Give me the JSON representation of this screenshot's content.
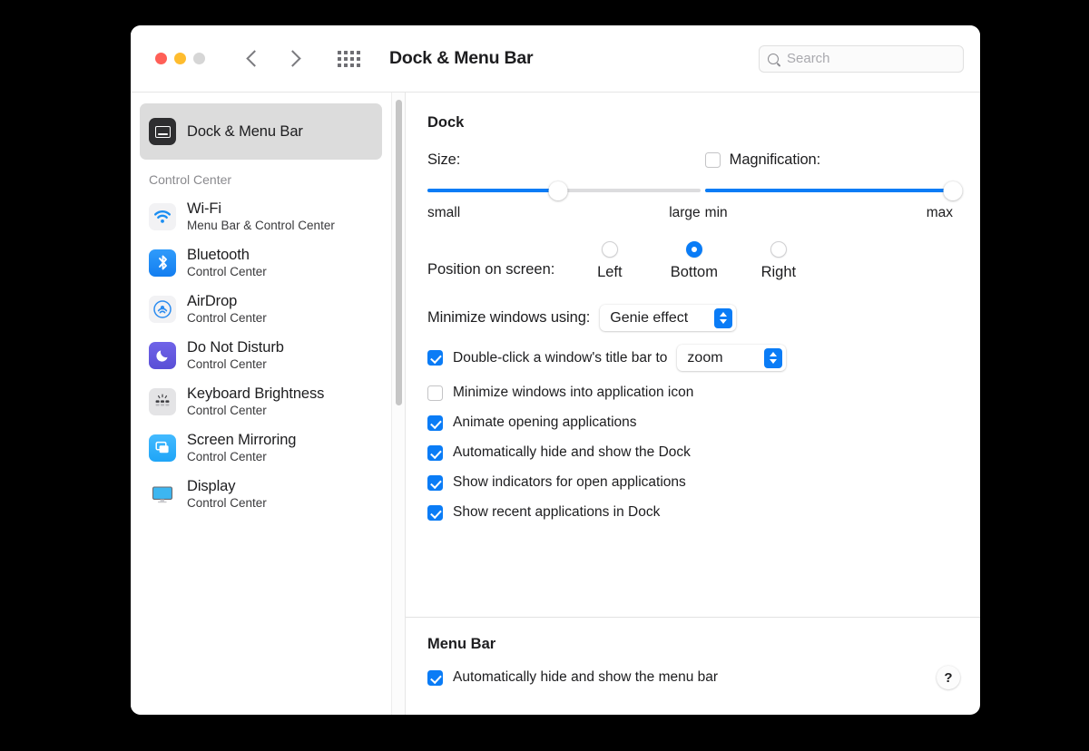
{
  "window": {
    "title": "Dock & Menu Bar",
    "traffic_lights": [
      "close",
      "minimize",
      "zoom"
    ],
    "nav_back": "back",
    "nav_forward": "forward",
    "grid_button": "show-all",
    "colors": {
      "accent": "#0a7cf6",
      "close": "#ff5f57",
      "minimize": "#febc2e",
      "zoom_disabled": "#d6d6d6",
      "selected_row": "#dcdcdc"
    }
  },
  "search": {
    "placeholder": "Search",
    "value": ""
  },
  "sidebar": {
    "selected": {
      "label": "Dock & Menu Bar",
      "icon": "dock-icon"
    },
    "group_label": "Control Center",
    "items": [
      {
        "label": "Wi-Fi",
        "sublabel": "Menu Bar & Control Center",
        "icon": "wifi-icon"
      },
      {
        "label": "Bluetooth",
        "sublabel": "Control Center",
        "icon": "bluetooth-icon"
      },
      {
        "label": "AirDrop",
        "sublabel": "Control Center",
        "icon": "airdrop-icon"
      },
      {
        "label": "Do Not Disturb",
        "sublabel": "Control Center",
        "icon": "moon-icon"
      },
      {
        "label": "Keyboard Brightness",
        "sublabel": "Control Center",
        "icon": "keyboard-icon"
      },
      {
        "label": "Screen Mirroring",
        "sublabel": "Control Center",
        "icon": "screen-mirroring-icon"
      },
      {
        "label": "Display",
        "sublabel": "Control Center",
        "icon": "display-icon"
      }
    ]
  },
  "dock": {
    "section_title": "Dock",
    "size": {
      "label": "Size:",
      "min_label": "small",
      "max_label": "large",
      "value_percent": 48
    },
    "magnification": {
      "label": "Magnification:",
      "checked": false,
      "min_label": "min",
      "max_label": "max",
      "value_percent": 100
    },
    "position": {
      "label": "Position on screen:",
      "options": [
        "Left",
        "Bottom",
        "Right"
      ],
      "selected": "Bottom"
    },
    "minimize_effect": {
      "label": "Minimize windows using:",
      "value": "Genie effect"
    },
    "double_click": {
      "checked": true,
      "label": "Double-click a window's title bar to",
      "value": "zoom"
    },
    "checkboxes": [
      {
        "label": "Minimize windows into application icon",
        "checked": false
      },
      {
        "label": "Animate opening applications",
        "checked": true
      },
      {
        "label": "Automatically hide and show the Dock",
        "checked": true
      },
      {
        "label": "Show indicators for open applications",
        "checked": true
      },
      {
        "label": "Show recent applications in Dock",
        "checked": true
      }
    ]
  },
  "menu_bar": {
    "section_title": "Menu Bar",
    "checkbox": {
      "label": "Automatically hide and show the menu bar",
      "checked": true
    },
    "help_label": "?"
  }
}
